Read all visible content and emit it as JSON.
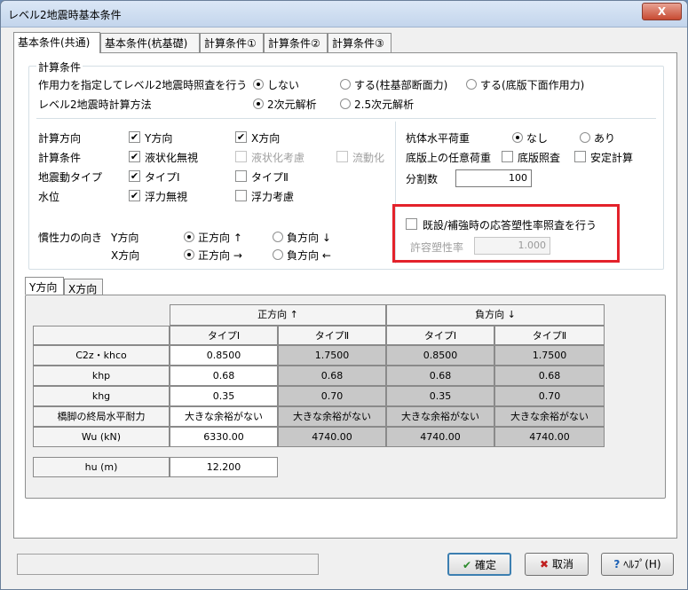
{
  "window": {
    "title": "レベル2地震時基本条件",
    "close": "X"
  },
  "tabs": [
    "基本条件(共通)",
    "基本条件(杭基礎)",
    "計算条件①",
    "計算条件②",
    "計算条件③"
  ],
  "calc_conditions": {
    "legend": "計算条件",
    "row1_label": "作用力を指定してレベル2地震時照査を行う",
    "row1_options": [
      "しない",
      "する(柱基部断面力)",
      "する(底版下面作用力)"
    ],
    "row2_label": "レベル2地震時計算方法",
    "row2_options": [
      "2次元解析",
      "2.5次元解析"
    ]
  },
  "left_grid": {
    "calc_direction": {
      "label": "計算方向",
      "y": "Y方向",
      "x": "X方向"
    },
    "calc_condition": {
      "label": "計算条件",
      "opt1": "液状化無視",
      "opt2": "液状化考慮",
      "opt3": "流動化"
    },
    "eq_type": {
      "label": "地震動タイプ",
      "opt1": "タイプⅠ",
      "opt2": "タイプⅡ"
    },
    "water": {
      "label": "水位",
      "opt1": "浮力無視",
      "opt2": "浮力考慮"
    },
    "inertia": {
      "label": "慣性力の向き",
      "y_label": "Y方向",
      "x_label": "X方向",
      "y_pos": "正方向 ↑",
      "y_neg": "負方向 ↓",
      "x_pos": "正方向 →",
      "x_neg": "負方向 ←"
    }
  },
  "right_grid": {
    "pile_horizontal": {
      "label": "杭体水平荷重",
      "none": "なし",
      "yes": "あり"
    },
    "base_load": {
      "label": "底版上の任意荷重",
      "opt1": "底版照査",
      "opt2": "安定計算"
    },
    "divisions": {
      "label": "分割数",
      "value": "100"
    },
    "existing": {
      "label": "既設/補強時の応答塑性率照査を行う",
      "ratio_label": "許容塑性率",
      "ratio_value": "1.000"
    }
  },
  "dir_tabs": [
    "Y方向",
    "X方向"
  ],
  "table": {
    "group_headers": [
      "正方向 ↑",
      "負方向 ↓"
    ],
    "sub_headers": [
      "タイプⅠ",
      "タイプⅡ",
      "タイプⅠ",
      "タイプⅡ"
    ],
    "rows": [
      {
        "label": "C2z・khco",
        "values": [
          "0.8500",
          "1.7500",
          "0.8500",
          "1.7500"
        ]
      },
      {
        "label": "khp",
        "values": [
          "0.68",
          "0.68",
          "0.68",
          "0.68"
        ]
      },
      {
        "label": "khg",
        "values": [
          "0.35",
          "0.70",
          "0.35",
          "0.70"
        ]
      },
      {
        "label": "橋脚の終局水平耐力",
        "values": [
          "大きな余裕がない",
          "大きな余裕がない",
          "大きな余裕がない",
          "大きな余裕がない"
        ]
      },
      {
        "label": "Wu (kN)",
        "values": [
          "6330.00",
          "4740.00",
          "4740.00",
          "4740.00"
        ]
      }
    ],
    "hu_label": "hu (m)",
    "hu_value": "12.200"
  },
  "buttons": {
    "ok": "確定",
    "cancel": "取消",
    "help": "ﾍﾙﾌﾟ(H)"
  },
  "colors": {
    "highlight": "#e3222b",
    "disabled_cell": "#c8c8c8"
  }
}
